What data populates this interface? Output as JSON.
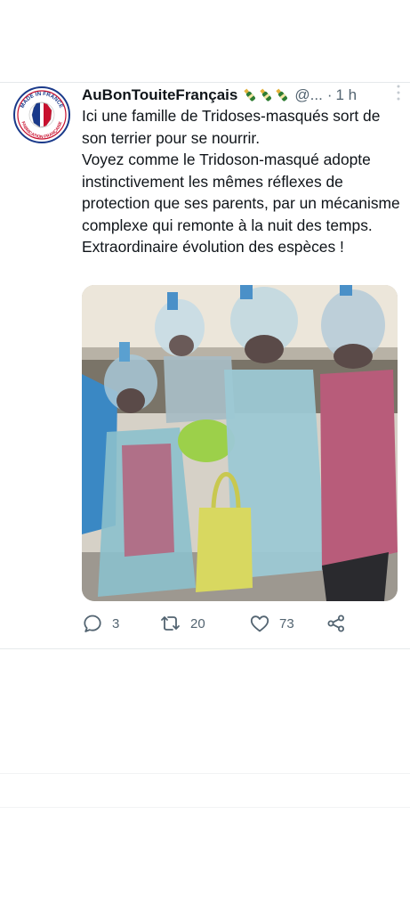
{
  "tweet": {
    "display_name": "AuBonTouiteFrançais",
    "handle": "@...",
    "separator": "·",
    "time": "1 h",
    "more_icon": "more-dots-icon",
    "avatar_icon": "made-in-france-badge",
    "avatar_text_top": "MADE IN FRANCE",
    "avatar_text_bottom": "FABRICATION FRANÇAISE",
    "name_emoji": "champagne-bottle-icon",
    "text_lines": [
      "Ici une famille de Tridoses-masqués sort de son terrier pour se nourrir.",
      "Voyez comme le Tridoson-masqué adopte instinctivement les mêmes réflexes de protection que ses parents, par un mécanisme complexe qui remonte à la nuit des temps.",
      "Extraordinaire évolution des espèces !"
    ],
    "media_icon": "photo",
    "actions": {
      "reply_icon": "reply-icon",
      "reply_count": "3",
      "retweet_icon": "retweet-icon",
      "retweet_count": "20",
      "like_icon": "heart-icon",
      "like_count": "73",
      "share_icon": "share-icon"
    }
  },
  "colors": {
    "text": "#0f1419",
    "secondary": "#536471",
    "divider": "#e6e9eb",
    "background": "#ffffff"
  }
}
